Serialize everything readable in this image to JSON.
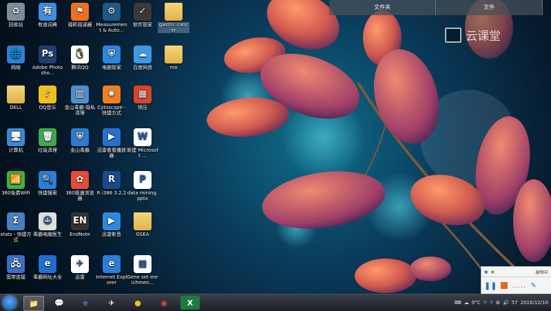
{
  "desktop_icons": [
    {
      "id": "recycle-bin",
      "label": "回收站",
      "col": 0,
      "row": 0,
      "color": "#7f8c99",
      "glyph": "♻"
    },
    {
      "id": "network",
      "label": "网络",
      "col": 0,
      "row": 1,
      "color": "#2e7fd0",
      "glyph": "🌐"
    },
    {
      "id": "dell",
      "label": "DELL",
      "col": 0,
      "row": 2,
      "color": "folder",
      "glyph": ""
    },
    {
      "id": "computer",
      "label": "计算机",
      "col": 0,
      "row": 3,
      "color": "#3a88d8",
      "glyph": "🖥"
    },
    {
      "id": "wifi-360",
      "label": "360免费WiFi",
      "col": 0,
      "row": 4,
      "color": "#3bb34a",
      "glyph": "📶"
    },
    {
      "id": "stats",
      "label": "stats - 快捷方式",
      "col": 0,
      "row": 5,
      "color": "#4a7fc0",
      "glyph": "Σ"
    },
    {
      "id": "broadband",
      "label": "宽带连接",
      "col": 0,
      "row": 6,
      "color": "#3a6fc8",
      "glyph": "🖧"
    },
    {
      "id": "youdao-dict",
      "label": "有道词典",
      "col": 1,
      "row": 0,
      "color": "#3b8fe0",
      "glyph": "有"
    },
    {
      "id": "photoshop",
      "label": "Adobe Photosho...",
      "col": 1,
      "row": 1,
      "color": "#1f3f6e",
      "glyph": "Ps"
    },
    {
      "id": "qq-music",
      "label": "QQ音乐",
      "col": 1,
      "row": 2,
      "color": "#f0c020",
      "glyph": "♪"
    },
    {
      "id": "junk-clean",
      "label": "垃圾清理",
      "col": 1,
      "row": 3,
      "color": "#3ea94d",
      "glyph": "🗑"
    },
    {
      "id": "quick-search",
      "label": "快捷搜索",
      "col": 1,
      "row": 4,
      "color": "#2a7fd8",
      "glyph": "🔍"
    },
    {
      "id": "master-lu",
      "label": "毒霸电脑医生",
      "col": 1,
      "row": 5,
      "color": "#e0e0e0",
      "glyph": "☺"
    },
    {
      "id": "web-nav",
      "label": "毒霸网址大全",
      "col": 1,
      "row": 6,
      "color": "#1e6fd0",
      "glyph": "e"
    },
    {
      "id": "foxit",
      "label": "福昕阅读器",
      "col": 2,
      "row": 0,
      "color": "#f07020",
      "glyph": "⚑"
    },
    {
      "id": "tencent-qq",
      "label": "腾讯QQ",
      "col": 2,
      "row": 1,
      "color": "#ffffff",
      "glyph": "🐧"
    },
    {
      "id": "kingsoft-privacy",
      "label": "金山毒霸-隐私清理",
      "col": 2,
      "row": 2,
      "color": "#4a90d0",
      "glyph": "▥"
    },
    {
      "id": "kingsoft",
      "label": "金山毒霸",
      "col": 2,
      "row": 3,
      "color": "#2b7bd1",
      "glyph": "⛨"
    },
    {
      "id": "browser-360",
      "label": "360极速浏览器",
      "col": 2,
      "row": 4,
      "color": "#e84a3a",
      "glyph": "✿"
    },
    {
      "id": "endnote",
      "label": "EndNote",
      "col": 2,
      "row": 5,
      "color": "#333333",
      "glyph": "EN"
    },
    {
      "id": "xunlei",
      "label": "迅雷",
      "col": 2,
      "row": 6,
      "color": "#ffffff",
      "glyph": "✈"
    },
    {
      "id": "measurement",
      "label": "Measurement & Auto...",
      "col": 3,
      "row": 0,
      "color": "#1a5a8a",
      "glyph": "⚙"
    },
    {
      "id": "pc-manager",
      "label": "电脑管家",
      "col": 3,
      "row": 1,
      "color": "#2b86e0",
      "glyph": "⛨"
    },
    {
      "id": "cytoscape",
      "label": "Cytoscape - 快捷方式",
      "col": 3,
      "row": 2,
      "color": "#f08020",
      "glyph": "✺"
    },
    {
      "id": "xunlei-player",
      "label": "迅雷看看播放器",
      "col": 3,
      "row": 3,
      "color": "#2a6fd0",
      "glyph": "▶"
    },
    {
      "id": "r-386",
      "label": "R i386 3.2.2",
      "col": 3,
      "row": 4,
      "color": "#1a4a8a",
      "glyph": "R"
    },
    {
      "id": "xunlei-video",
      "label": "迅雷影音",
      "col": 3,
      "row": 5,
      "color": "#2d8ae0",
      "glyph": "▶"
    },
    {
      "id": "ie",
      "label": "Internet Explorer",
      "col": 3,
      "row": 6,
      "color": "#2a7fd8",
      "glyph": "e"
    },
    {
      "id": "software-manager",
      "label": "软件管家",
      "col": 4,
      "row": 0,
      "color": "#3a3a3a",
      "glyph": "✓"
    },
    {
      "id": "baidu-disk",
      "label": "百度网盘",
      "col": 4,
      "row": 1,
      "color": "#3a9ae8",
      "glyph": "☁"
    },
    {
      "id": "kuaiya",
      "label": "快压",
      "col": 4,
      "row": 2,
      "color": "#d8452a",
      "glyph": "▦"
    },
    {
      "id": "new-word",
      "label": "新建 Microsoft ...",
      "col": 4,
      "row": 3,
      "color": "#ffffff",
      "glyph": "W"
    },
    {
      "id": "data-mining",
      "label": "data mining.pptx",
      "col": 4,
      "row": 4,
      "color": "#ffffff",
      "glyph": "P"
    },
    {
      "id": "gsea",
      "label": "GSEA",
      "col": 4,
      "row": 5,
      "color": "folder",
      "glyph": ""
    },
    {
      "id": "gene-set",
      "label": "Gene set enrichmen...",
      "col": 4,
      "row": 6,
      "color": "#ffffff",
      "glyph": "▤"
    },
    {
      "id": "gastric-cancer",
      "label": "gastric cancer",
      "col": 5,
      "row": 0,
      "color": "folder",
      "glyph": "",
      "selected": true
    },
    {
      "id": "mo",
      "label": "mo",
      "col": 5,
      "row": 1,
      "color": "folder",
      "glyph": ""
    }
  ],
  "topbar": {
    "item1": "文件夹",
    "item2": "文件"
  },
  "watermark": {
    "text": "云课堂"
  },
  "recorder": {
    "status": "录制中.",
    "dots": "....."
  },
  "taskbar": {
    "items": [
      {
        "id": "explorer",
        "glyph": "📁",
        "active": true
      },
      {
        "id": "wechat",
        "glyph": "💬",
        "active": false
      },
      {
        "id": "ie",
        "glyph": "e",
        "active": false
      },
      {
        "id": "xunlei",
        "glyph": "✈",
        "active": false
      },
      {
        "id": "qq-music",
        "glyph": "●",
        "active": false
      },
      {
        "id": "chrome",
        "glyph": "◉",
        "active": false
      },
      {
        "id": "excel",
        "glyph": "X",
        "active": false
      }
    ],
    "weather": "9°C",
    "volume_level": "57",
    "date": "2016/12/10"
  }
}
